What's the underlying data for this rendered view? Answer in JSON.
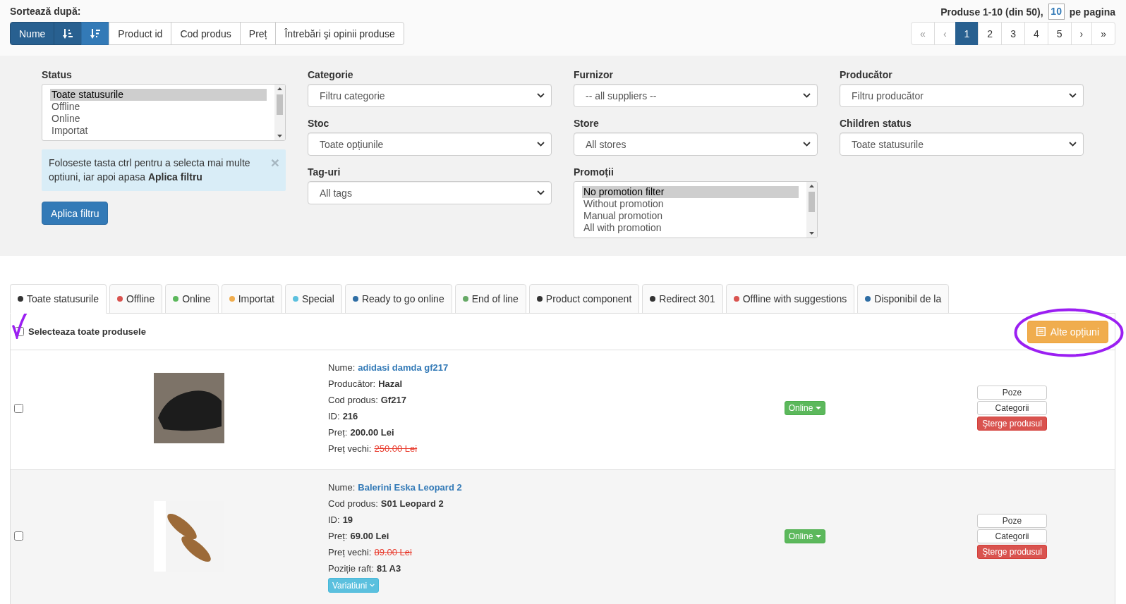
{
  "sort": {
    "label": "Sortează după:",
    "options": [
      {
        "kind": "text",
        "label": "Nume",
        "selected": true
      },
      {
        "kind": "sort-asc",
        "selected": true
      },
      {
        "kind": "sort-desc",
        "selected": false
      },
      {
        "kind": "text",
        "label": "Product id",
        "selected": false
      },
      {
        "kind": "text",
        "label": "Cod produs",
        "selected": false
      },
      {
        "kind": "text",
        "label": "Preț",
        "selected": false
      },
      {
        "kind": "text",
        "label": "Întrebări şi opinii produse",
        "selected": false
      }
    ]
  },
  "paging": {
    "summary": "Produse 1-10 (din 50),",
    "per_page": "10",
    "per_page_label": "pe pagina",
    "pages": [
      {
        "label": "«",
        "selected": false,
        "disabled": true
      },
      {
        "label": "‹",
        "selected": false,
        "disabled": true
      },
      {
        "label": "1",
        "selected": true,
        "disabled": false
      },
      {
        "label": "2",
        "selected": false,
        "disabled": false
      },
      {
        "label": "3",
        "selected": false,
        "disabled": false
      },
      {
        "label": "4",
        "selected": false,
        "disabled": false
      },
      {
        "label": "5",
        "selected": false,
        "disabled": false
      },
      {
        "label": "›",
        "selected": false,
        "disabled": false
      },
      {
        "label": "»",
        "selected": false,
        "disabled": false
      }
    ]
  },
  "filters": {
    "columns": [
      [
        {
          "kind": "listbox",
          "label": "Status",
          "options": [
            {
              "label": "Toate statusurile",
              "selected": true
            },
            {
              "label": "Offline",
              "selected": false
            },
            {
              "label": "Online",
              "selected": false
            },
            {
              "label": "Importat",
              "selected": false
            }
          ]
        },
        {
          "kind": "hint",
          "text": "Foloseste tasta ctrl pentru a selecta mai multe optiuni, iar apoi apasa **Aplica filtru**",
          "close": "×"
        },
        {
          "kind": "button",
          "label": "Aplica filtru"
        }
      ],
      [
        {
          "kind": "select",
          "label": "Categorie",
          "value": "Filtru categorie"
        },
        {
          "kind": "select",
          "label": "Stoc",
          "value": "Toate opțiunile"
        },
        {
          "kind": "select",
          "label": "Tag-uri",
          "value": "All tags"
        }
      ],
      [
        {
          "kind": "select",
          "label": "Furnizor",
          "value": "-- all suppliers --"
        },
        {
          "kind": "select",
          "label": "Store",
          "value": "All stores"
        },
        {
          "kind": "listbox",
          "label": "Promoții",
          "options": [
            {
              "label": "No promotion filter",
              "selected": true
            },
            {
              "label": "Without promotion",
              "selected": false
            },
            {
              "label": "Manual promotion",
              "selected": false
            },
            {
              "label": "All with promotion",
              "selected": false
            }
          ]
        }
      ],
      [
        {
          "kind": "select",
          "label": "Producător",
          "value": "Filtru producător"
        },
        {
          "kind": "select",
          "label": "Children status",
          "value": "Toate statusurile"
        }
      ]
    ]
  },
  "status_tabs": [
    {
      "label": "Toate statusurile",
      "color": "#333333",
      "selected": true
    },
    {
      "label": "Offline",
      "color": "#d9534f",
      "selected": false
    },
    {
      "label": "Online",
      "color": "#5cb85c",
      "selected": false
    },
    {
      "label": "Importat",
      "color": "#f0ad4e",
      "selected": false
    },
    {
      "label": "Special",
      "color": "#5bc0de",
      "selected": false
    },
    {
      "label": "Ready to go online",
      "color": "#2e6da4",
      "selected": false
    },
    {
      "label": "End of line",
      "color": "#66a966",
      "selected": false
    },
    {
      "label": "Product component",
      "color": "#333333",
      "selected": false
    },
    {
      "label": "Redirect 301",
      "color": "#333333",
      "selected": false
    },
    {
      "label": "Offline with suggestions",
      "color": "#d9534f",
      "selected": false
    },
    {
      "label": "Disponibil de la",
      "color": "#2e6da4",
      "selected": false
    }
  ],
  "toolbar": {
    "select_all": {
      "label": "Selecteaza toate produsele",
      "checked": false
    },
    "more_options": "Alte opțiuni"
  },
  "products": [
    {
      "checked": false,
      "fields": [
        {
          "kind": "link",
          "label": "Nume:",
          "value": "adidasi damda gf217"
        },
        {
          "kind": "bold",
          "label": "Producător:",
          "value": "Hazal"
        },
        {
          "kind": "bold",
          "label": "Cod produs:",
          "value": "Gf217"
        },
        {
          "kind": "bold",
          "label": "ID:",
          "value": "216"
        },
        {
          "kind": "bold",
          "label": "Preț:",
          "value": "200.00 Lei"
        },
        {
          "kind": "old-price",
          "label": "Preț vechi:",
          "value": "250.00 Lei"
        }
      ],
      "status": "Online",
      "actions": [
        {
          "kind": "default",
          "label": "Poze"
        },
        {
          "kind": "default",
          "label": "Categorii"
        },
        {
          "kind": "danger",
          "label": "Şterge produsul"
        }
      ]
    },
    {
      "checked": false,
      "fields": [
        {
          "kind": "link",
          "label": "Nume:",
          "value": "Balerini Eska Leopard 2"
        },
        {
          "kind": "bold",
          "label": "Cod produs:",
          "value": "S01 Leopard 2"
        },
        {
          "kind": "bold",
          "label": "ID:",
          "value": "19"
        },
        {
          "kind": "bold",
          "label": "Preț:",
          "value": "69.00 Lei"
        },
        {
          "kind": "old-price",
          "label": "Preț vechi:",
          "value": "89.00 Lei"
        },
        {
          "kind": "bold",
          "label": "Poziție raft:",
          "value": "81 A3"
        }
      ],
      "variations": "Variatiuni",
      "status": "Online",
      "actions": [
        {
          "kind": "default",
          "label": "Poze"
        },
        {
          "kind": "default",
          "label": "Categorii"
        },
        {
          "kind": "danger",
          "label": "Şterge produsul"
        }
      ]
    }
  ]
}
